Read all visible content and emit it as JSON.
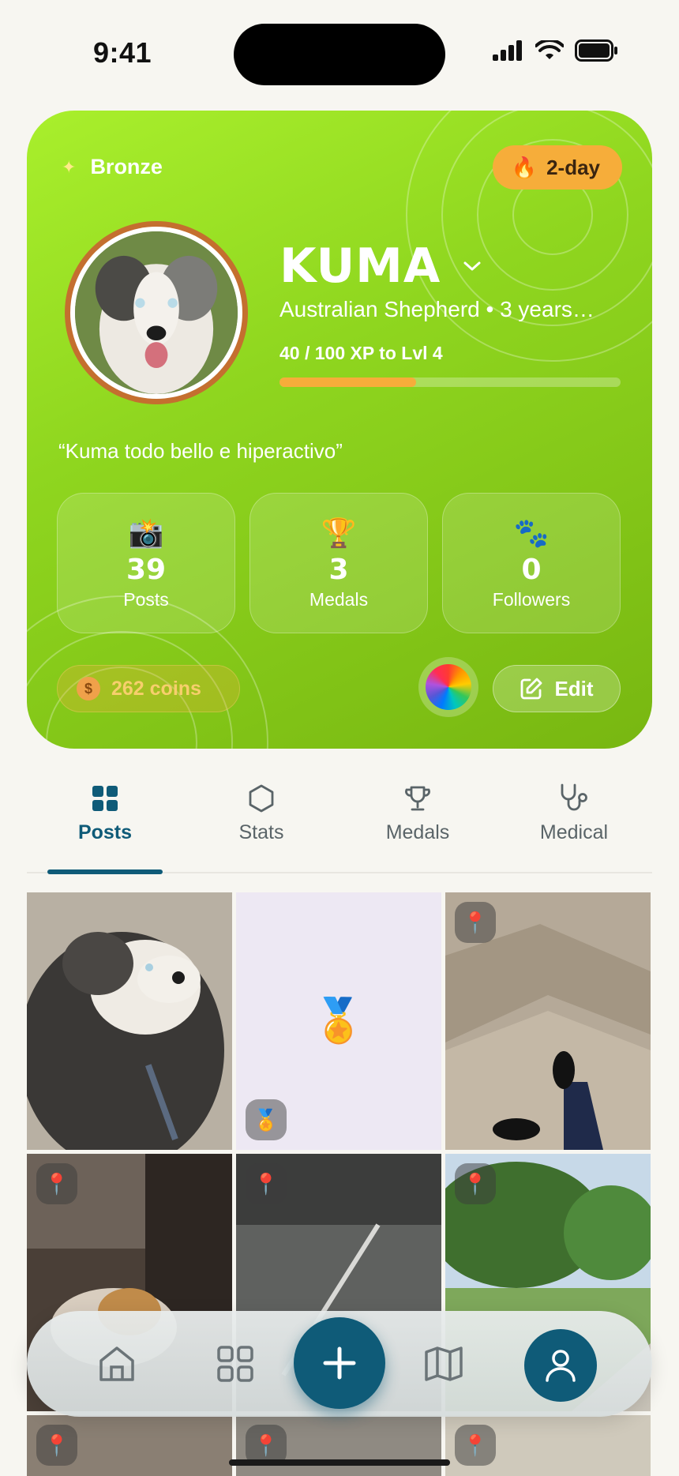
{
  "status_bar": {
    "time": "9:41"
  },
  "profile": {
    "tier": "Bronze",
    "streak": "2-day",
    "streak_icon": "fire-icon",
    "name": "KUMA",
    "breed_age": "Australian Shepherd • 3 years…",
    "xp_text": "40 / 100 XP to Lvl 4",
    "xp_progress": 0.4,
    "bio": "“Kuma todo bello e hiperactivo”",
    "stats": [
      {
        "icon": "camera-icon",
        "glyph": "📸",
        "value": "39",
        "label": "Posts"
      },
      {
        "icon": "trophy-icon",
        "glyph": "🏆",
        "value": "3",
        "label": "Medals"
      },
      {
        "icon": "paws-icon",
        "glyph": "🐾",
        "value": "0",
        "label": "Followers"
      }
    ],
    "coins": "262 coins",
    "edit_label": "Edit"
  },
  "tabs": [
    {
      "label": "Posts",
      "icon": "grid-icon",
      "active": true
    },
    {
      "label": "Stats",
      "icon": "hexagon-icon",
      "active": false
    },
    {
      "label": "Medals",
      "icon": "trophy-outline-icon",
      "active": false
    },
    {
      "label": "Medical",
      "icon": "stethoscope-icon",
      "active": false
    }
  ],
  "posts": [
    {
      "kind": "photo",
      "subject": "dog lying on gravel",
      "colors": [
        "#b9b2a6",
        "#2e2c2a",
        "#f1eee8"
      ]
    },
    {
      "kind": "medal",
      "colors": [
        "#ede8f3"
      ]
    },
    {
      "kind": "photo",
      "subject": "tile floor with shoes",
      "pin": true,
      "colors": [
        "#b7ab9a",
        "#8e8171"
      ]
    },
    {
      "kind": "photo",
      "subject": "cat on chair",
      "pin": true,
      "colors": [
        "#5a4c42",
        "#3a322c"
      ]
    },
    {
      "kind": "photo",
      "subject": "gym floor barbell",
      "pin": true,
      "colors": [
        "#5e605f",
        "#3d3f3f"
      ]
    },
    {
      "kind": "photo",
      "subject": "park with trees",
      "pin": true,
      "colors": [
        "#4f8a3c",
        "#8cb36a",
        "#c7d9e8"
      ]
    },
    {
      "kind": "photo",
      "subject": "room",
      "pin": true,
      "colors": [
        "#8a7f73"
      ]
    },
    {
      "kind": "photo",
      "subject": "floor",
      "pin": true,
      "colors": [
        "#8f8a82"
      ]
    },
    {
      "kind": "photo",
      "subject": "plant",
      "pin": true,
      "colors": [
        "#cfc9bb"
      ]
    }
  ],
  "bottom_nav": {
    "items": [
      "home-icon",
      "apps-grid-icon",
      "plus-icon",
      "map-icon",
      "person-icon"
    ]
  }
}
